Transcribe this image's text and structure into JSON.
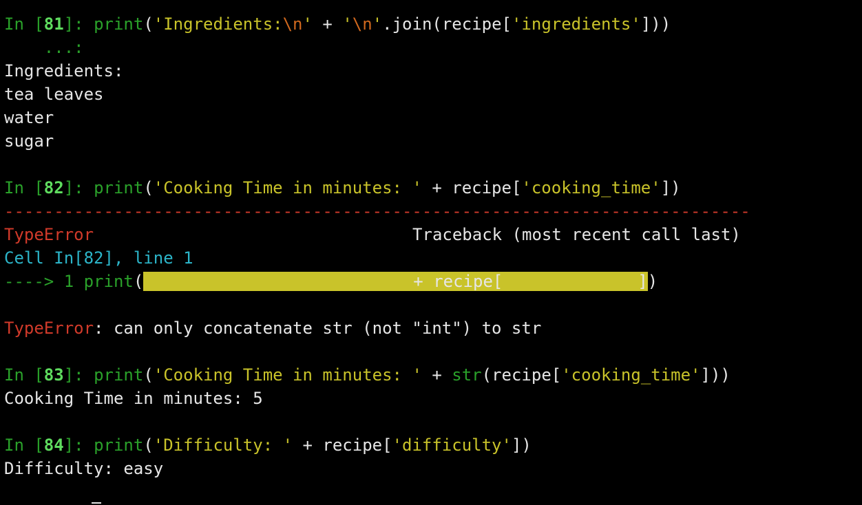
{
  "cells": [
    {
      "prompt": {
        "in": "In [",
        "num": "81",
        "close": "]: "
      },
      "code": {
        "fn": "print",
        "open": "(",
        "str1": "'Ingredients:",
        "esc1": "\\n",
        "str1_end": "'",
        "plus": " + ",
        "str2_start": "'",
        "esc2": "\\n",
        "str2_end": "'",
        "join": ".join(recipe[",
        "key": "'ingredients'",
        "close": "]))"
      },
      "continuation": "    ...:",
      "output": [
        "Ingredients:",
        "tea leaves",
        "water",
        "sugar"
      ]
    },
    {
      "prompt": {
        "in": "In [",
        "num": "82",
        "close": "]: "
      },
      "code": {
        "fn": "print",
        "open": "(",
        "str": "'Cooking Time in minutes: '",
        "mid": " + recipe[",
        "key": "'cooking_time'",
        "close": "])"
      },
      "error": {
        "rule": "---------------------------------------------------------------------------",
        "type": "TypeError",
        "traceback": "Traceback (most recent call last)",
        "cell_ref": "Cell In[82], line 1",
        "arrow": "----> 1 ",
        "arrow_fn": "print",
        "arrow_open": "(",
        "arrow_hl_mid": "+ recipe[",
        "arrow_hl_end": "]",
        "arrow_close": ")",
        "message_type": "TypeError",
        "message": ": can only concatenate str (not \"int\") to str"
      }
    },
    {
      "prompt": {
        "in": "In [",
        "num": "83",
        "close": "]: "
      },
      "code": {
        "fn": "print",
        "open": "(",
        "str": "'Cooking Time in minutes: '",
        "plus": " + ",
        "fn2": "str",
        "mid": "(recipe[",
        "key": "'cooking_time'",
        "close": "]))"
      },
      "output": [
        "Cooking Time in minutes: 5"
      ]
    },
    {
      "prompt": {
        "in": "In [",
        "num": "84",
        "close": "]: "
      },
      "code": {
        "fn": "print",
        "open": "(",
        "str": "'Difficulty: '",
        "mid": " + recipe[",
        "key": "'difficulty'",
        "close": "])"
      },
      "output": [
        "Difficulty: easy"
      ]
    }
  ],
  "colors": {
    "background": "#000000",
    "prompt": "#2aa12a",
    "prompt_number": "#5fdc5f",
    "string": "#c9c32a",
    "escape": "#d2691e",
    "error": "#d13a2a",
    "cell_ref": "#2cb5c9",
    "text": "#e6e6e6"
  }
}
